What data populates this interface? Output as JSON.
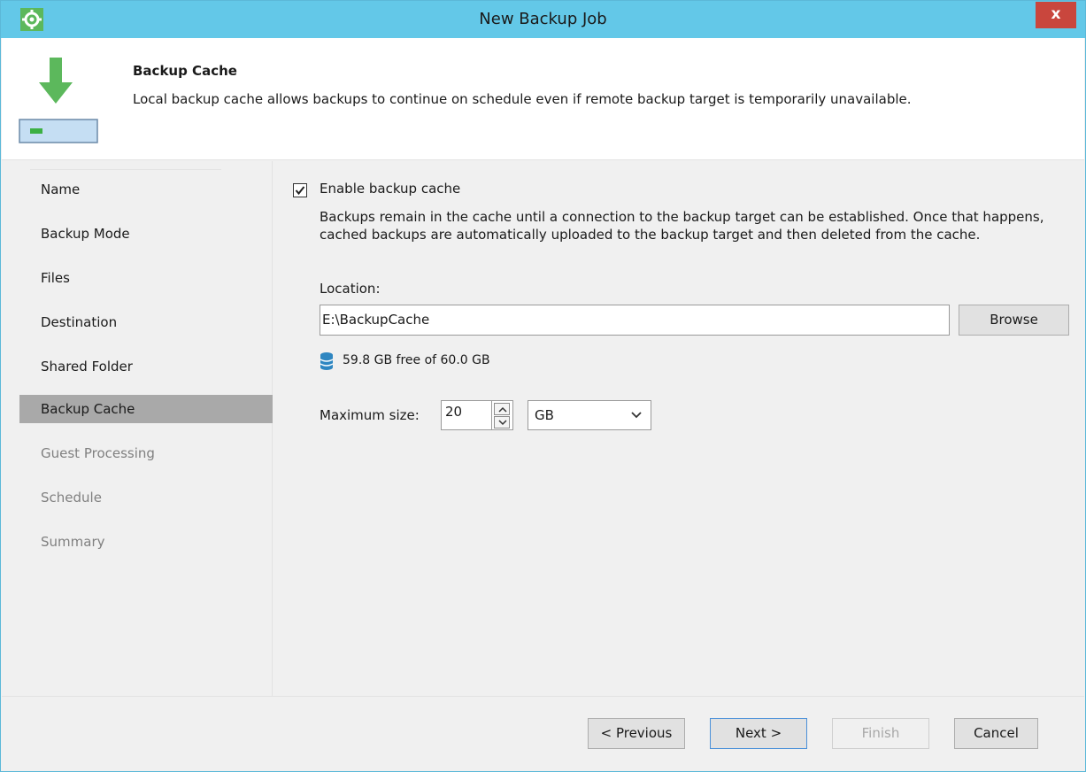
{
  "window": {
    "title": "New Backup Job",
    "close_label": "x"
  },
  "header": {
    "title": "Backup Cache",
    "description": "Local backup cache allows backups to continue on schedule even if remote backup target is temporarily unavailable."
  },
  "steps": [
    {
      "label": "Name",
      "state": "done"
    },
    {
      "label": "Backup Mode",
      "state": "done"
    },
    {
      "label": "Files",
      "state": "done"
    },
    {
      "label": "Destination",
      "state": "done"
    },
    {
      "label": "Shared Folder",
      "state": "done"
    },
    {
      "label": "Backup Cache",
      "state": "active"
    },
    {
      "label": "Guest Processing",
      "state": "disabled"
    },
    {
      "label": "Schedule",
      "state": "disabled"
    },
    {
      "label": "Summary",
      "state": "disabled"
    }
  ],
  "cache": {
    "enable_label": "Enable backup cache",
    "enabled": true,
    "description": "Backups remain in the cache until a connection to the backup target can be established. Once that happens, cached backups are automatically uploaded to the backup target and then deleted from the cache.",
    "location_label": "Location:",
    "location_value": "E:\\BackupCache",
    "browse_label": "Browse",
    "free_space": "59.8 GB free of 60.0 GB",
    "max_size_label": "Maximum size:",
    "max_size_value": "20",
    "unit_value": "GB"
  },
  "footer": {
    "previous_label": "< Previous",
    "next_label": "Next >",
    "finish_label": "Finish",
    "cancel_label": "Cancel"
  },
  "colors": {
    "titlebar": "#63c8e8",
    "close_button": "#c9463d",
    "active_step": "#a9a9a9",
    "icon_green": "#5cb85c",
    "database_blue": "#2e86c1"
  },
  "icons": {
    "app": "gear-icon",
    "header": "backup-cache-download-icon",
    "storage": "database-icon"
  }
}
